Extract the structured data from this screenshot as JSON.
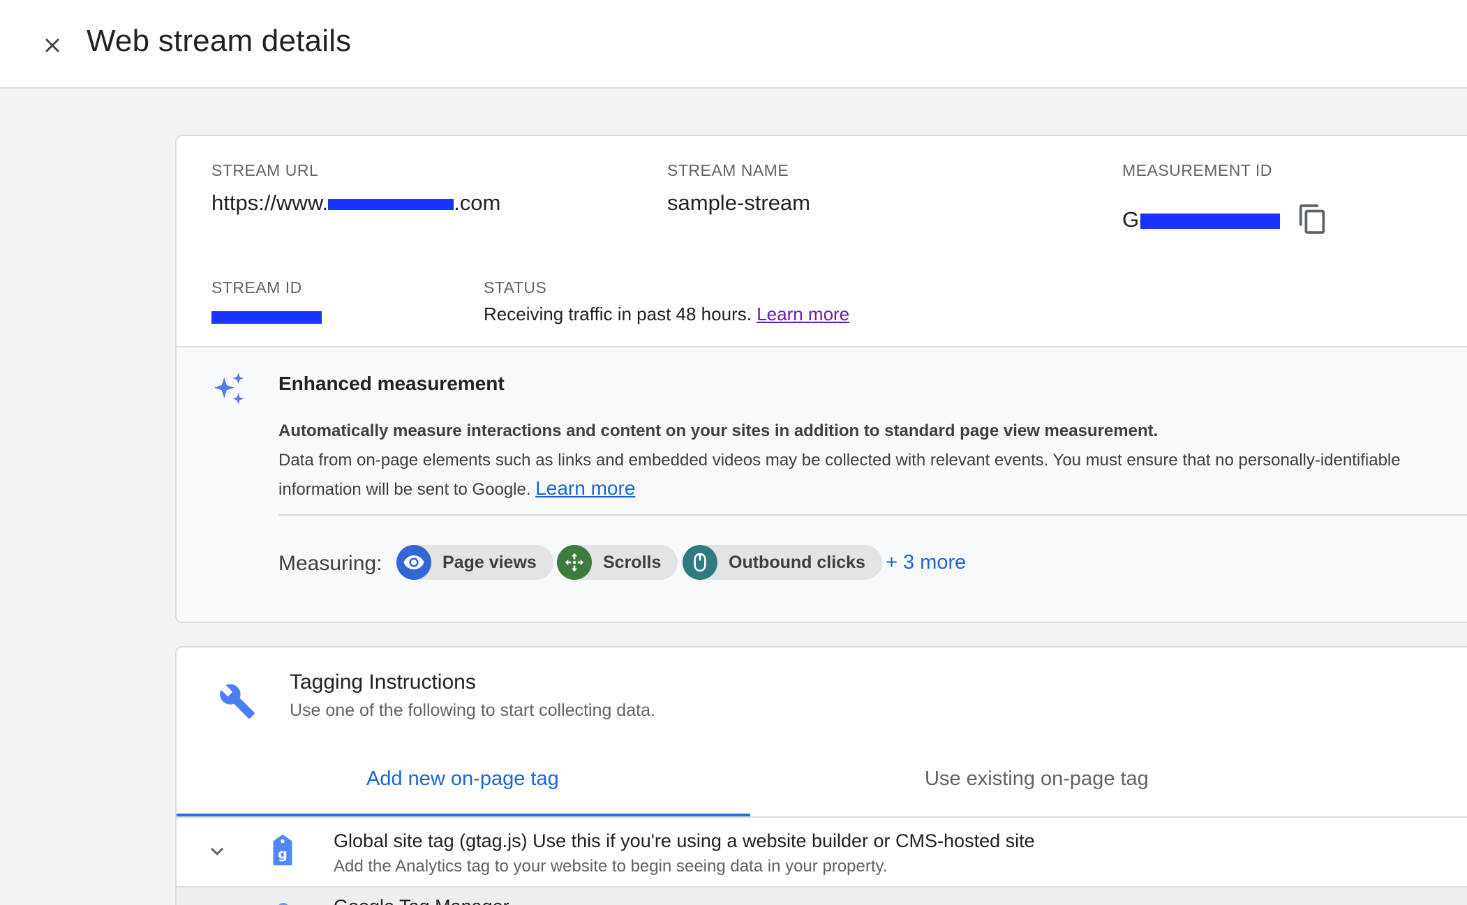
{
  "header": {
    "title": "Web stream details"
  },
  "stream": {
    "url_label": "STREAM URL",
    "url_prefix": "https://www.",
    "url_suffix": ".com",
    "name_label": "STREAM NAME",
    "name_value": "sample-stream",
    "measurement_label": "MEASUREMENT ID",
    "measurement_prefix": "G-",
    "stream_id_label": "STREAM ID",
    "status_label": "STATUS",
    "status_text": "Receiving traffic in past 48 hours.",
    "status_link": "Learn more"
  },
  "enhanced": {
    "title": "Enhanced measurement",
    "bold_text": "Automatically measure interactions and content on your sites in addition to standard page view measurement.",
    "desc_text": "Data from on-page elements such as links and embedded videos may be collected with relevant events. You must ensure that no personally-identifiable information will be sent to Google.",
    "learn_more": "Learn more",
    "measuring_label": "Measuring:",
    "chips": [
      {
        "label": "Page views",
        "icon": "eye-icon",
        "color": "#3367d6"
      },
      {
        "label": "Scrolls",
        "icon": "scroll-arrows-icon",
        "color": "#3c7d3e"
      },
      {
        "label": "Outbound clicks",
        "icon": "mouse-icon",
        "color": "#2f7b7e"
      }
    ],
    "more_link": "+ 3 more"
  },
  "tagging": {
    "title": "Tagging Instructions",
    "subtitle": "Use one of the following to start collecting data.",
    "tabs": [
      {
        "label": "Add new on-page tag",
        "active": true
      },
      {
        "label": "Use existing on-page tag",
        "active": false
      }
    ],
    "gtag": {
      "title_bold": "Global site tag (gtag.js)",
      "title_rest": " Use this if you're using a website builder or CMS-hosted site",
      "subtitle": "Add the Analytics tag to your website to begin seeing data in your property."
    },
    "gtm": {
      "title": "Google Tag Manager"
    }
  },
  "colors": {
    "accent": "#1a73e8",
    "link_purple": "#681da8",
    "redaction": "#1a33ff"
  }
}
